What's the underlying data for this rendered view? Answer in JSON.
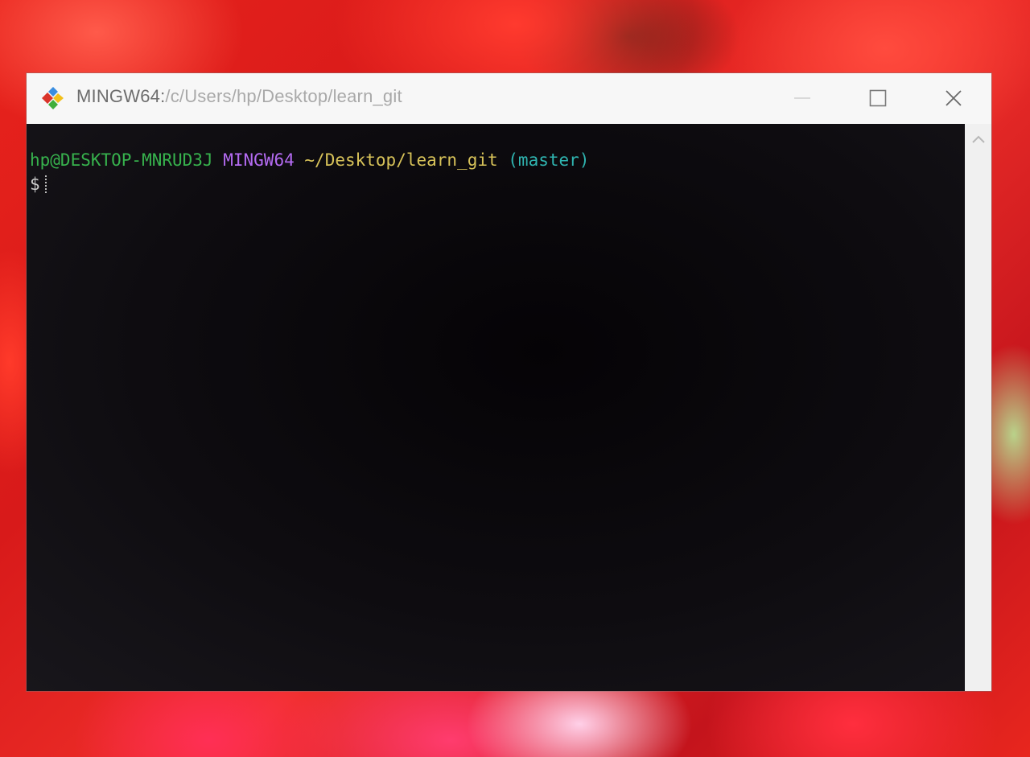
{
  "window": {
    "title_prefix": "MINGW64:",
    "title_path": "/c/Users/hp/Desktop/learn_git",
    "app_icon": "git-bash-icon",
    "controls": {
      "minimize": "minimize-icon",
      "maximize": "maximize-icon",
      "close": "close-icon"
    }
  },
  "terminal": {
    "prompt": {
      "user_host": "hp@DESKTOP-MNRUD3J",
      "system": "MINGW64",
      "cwd": "~/Desktop/learn_git",
      "branch": "(master)",
      "symbol": "$"
    },
    "colors": {
      "user_host": "#37b24d",
      "system": "#b46bf2",
      "cwd": "#d7c259",
      "branch": "#2fb4b0",
      "background": "#0e0c10"
    }
  },
  "scrollbar": {
    "up_arrow": "chevron-up-icon"
  }
}
